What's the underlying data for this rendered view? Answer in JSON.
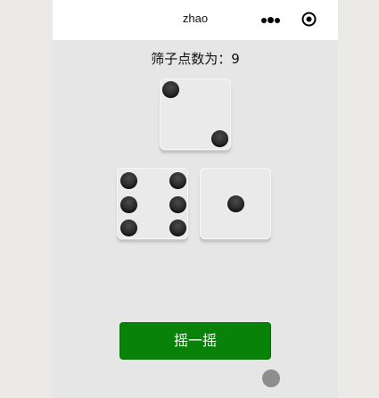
{
  "navbar": {
    "title": "zhao",
    "menu_icon": "more-dots-icon",
    "close_icon": "capsule-close-icon"
  },
  "game": {
    "score_label": "筛子点数为：9",
    "dice": [
      {
        "value": 2
      },
      {
        "value": 6
      },
      {
        "value": 1
      }
    ]
  },
  "shake_button": {
    "label": "摇一摇",
    "color": "#088208"
  },
  "floating_ball": {
    "icon": "floating-assist-ball-icon"
  }
}
